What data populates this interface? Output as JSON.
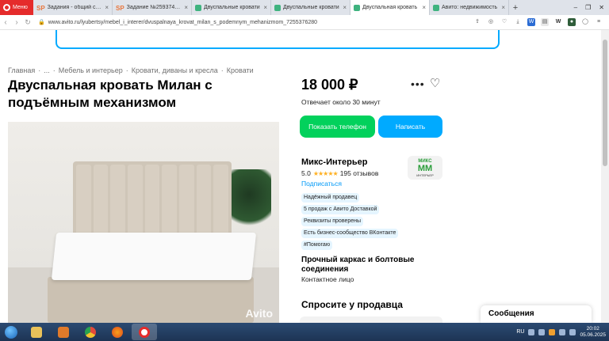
{
  "browser": {
    "menu_label": "Меню",
    "tabs": [
      {
        "title": "Задания - общий спис",
        "icon_color": "#e8763c",
        "prefix": "SP"
      },
      {
        "title": "Задание №2593747 - С",
        "icon_color": "#e8763c",
        "prefix": "SP"
      },
      {
        "title": "Двуспальные кровати",
        "icon_color": "#3fb37f",
        "prefix": ""
      },
      {
        "title": "Двуспальные кровати",
        "icon_color": "#3fb37f",
        "prefix": ""
      },
      {
        "title": "Двуспальная кровать",
        "icon_color": "#3fb37f",
        "prefix": ""
      },
      {
        "title": "Авито: недвижимость",
        "icon_color": "#3fb37f",
        "prefix": ""
      }
    ],
    "url": "www.avito.ru/lyubertsy/mebel_i_interer/dvuspalnaya_krovat_milan_s_podemnym_mehanizmom_7255376280"
  },
  "breadcrumb": [
    "Главная",
    "·",
    "...",
    "·",
    "Мебель и интерьер",
    "·",
    "Кровати, диваны и кресла",
    "·",
    "Кровати"
  ],
  "listing": {
    "title": "Двуспальная кровать Милан с подъёмным механизмом",
    "price": "18 000 ₽",
    "reply_time": "Отвечает около 30 минут",
    "phone_button": "Показать телефон",
    "message_button": "Написать",
    "photo_watermark": "Avito"
  },
  "seller": {
    "name": "Микс-Интерьер",
    "rating": "5.0",
    "stars": "★★★★★",
    "reviews": "195 отзывов",
    "subscribe": "Подписаться",
    "logo_line1": "МИКС",
    "logo_line2": "ММ",
    "logo_line3": "ИНТЕРЬЕР",
    "badges": [
      "Надёжный продавец",
      "5 продаж с Авито Доставкой",
      "Реквизиты проверены",
      "Есть бизнес-сообщество ВКонтакте",
      "#Помогаю"
    ],
    "feature": "Прочный каркас и болтовые соединения",
    "contact": "Контактное лицо"
  },
  "ask_seller": "Спросите у продавца",
  "messages_panel": "Сообщения",
  "taskbar": {
    "lang": "RU",
    "time": "20:02",
    "date": "05.06.2025"
  },
  "colors": {
    "phone_button": "#02d15c",
    "message_button": "#00aaff",
    "link": "#0099f7",
    "star": "#ffb021",
    "opera_red": "#e52b2b"
  }
}
